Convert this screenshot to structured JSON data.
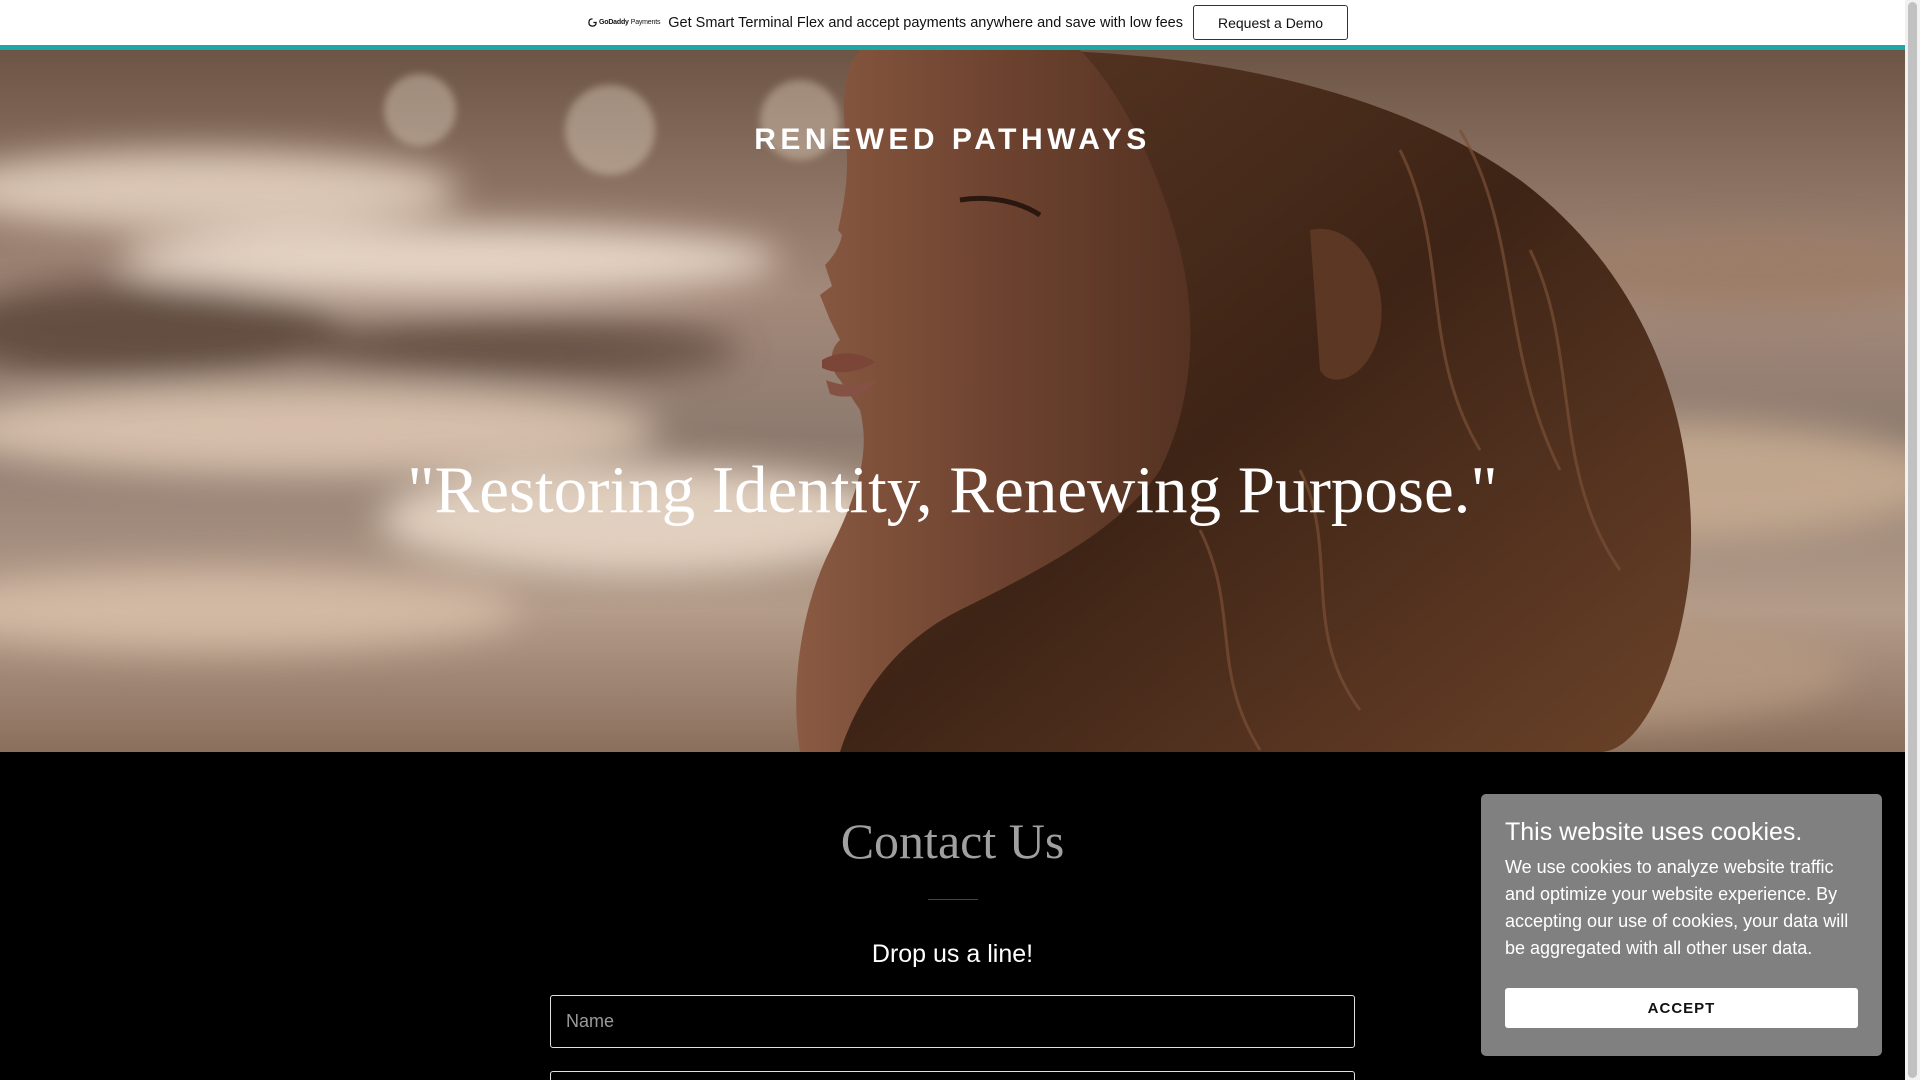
{
  "promo_bar": {
    "logo_brand": "GoDaddy",
    "logo_sub": "Payments",
    "message": "Get Smart Terminal Flex and accept payments anywhere and save with low fees",
    "cta_label": "Request a Demo",
    "accent_color": "#1fa7a5"
  },
  "hero": {
    "site_title": "RENEWED PATHWAYS",
    "tagline": "\"Restoring Identity, Renewing Purpose.\""
  },
  "contact": {
    "title": "Contact Us",
    "subheading": "Drop us a line!",
    "name_placeholder": "Name",
    "email_placeholder": ""
  },
  "cookie_banner": {
    "title": "This website uses cookies.",
    "body": "We use cookies to analyze website traffic and optimize your website experience. By accepting our use of cookies, your data will be aggregated with all other user data.",
    "accept_label": "ACCEPT"
  }
}
